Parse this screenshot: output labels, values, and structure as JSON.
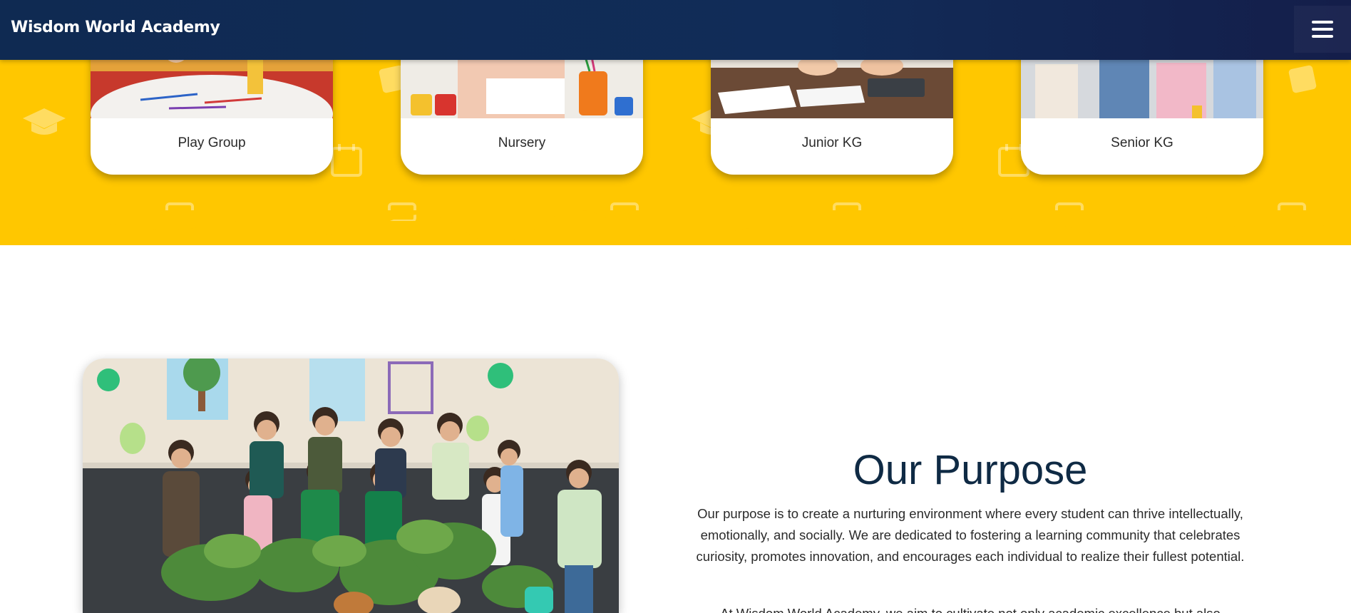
{
  "header": {
    "brand": "Wisdom World Academy",
    "menu_icon": "hamburger-menu-icon"
  },
  "programs": [
    {
      "label": "Play Group"
    },
    {
      "label": "Nursery"
    },
    {
      "label": "Junior KG"
    },
    {
      "label": "Senior KG"
    }
  ],
  "purpose": {
    "title": "Our Purpose",
    "paragraph1": "Our purpose is to create a nurturing environment where every student can thrive intellectually, emotionally, and socially. We are dedicated to fostering a learning community that celebrates curiosity, promotes innovation, and encourages each individual to realize their fullest potential.",
    "paragraph2_partial": "At Wisdom World Academy, we aim to cultivate not only academic excellence but also"
  },
  "colors": {
    "navbar": "#112c58",
    "band": "#ffc700",
    "title": "#0f2a44"
  }
}
